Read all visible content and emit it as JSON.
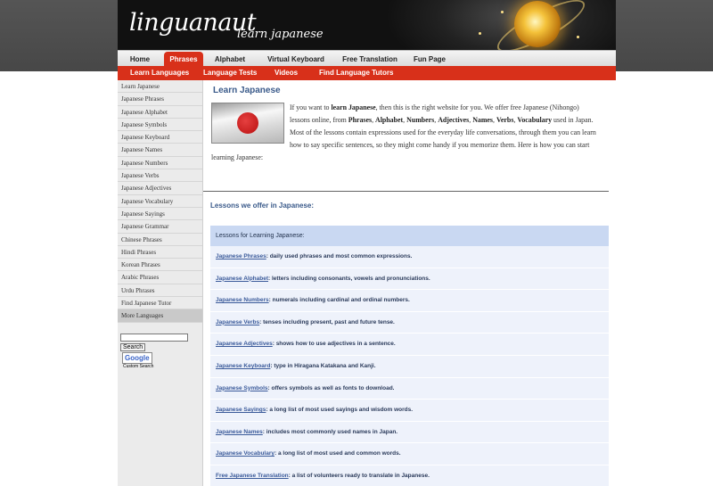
{
  "banner": {
    "logo": "linguanaut",
    "tagline": "learn japanese"
  },
  "nav_main": [
    {
      "label": "Home",
      "active": false
    },
    {
      "label": "Phrases",
      "active": true
    },
    {
      "label": "Alphabet",
      "active": false
    },
    {
      "label": "Virtual Keyboard",
      "active": false
    },
    {
      "label": "Free Translation",
      "active": false
    },
    {
      "label": "Fun Page",
      "active": false
    }
  ],
  "nav_sub": [
    "Learn Languages",
    "Language Tests",
    "Videos",
    "Find Language Tutors"
  ],
  "sidebar": {
    "items": [
      "Learn Japanese",
      "Japanese Phrases",
      "Japanese Alphabet",
      "Japanese Symbols",
      "Japanese Keyboard",
      "Japanese Names",
      "Japanese Numbers",
      "Japanese Verbs",
      "Japanese Adjectives",
      "Japanese Vocabulary",
      "Japanese Sayings",
      "Japanese Grammar",
      "Chinese Phrases",
      "Hindi Phrases",
      "Korean Phrases",
      "Arabic Phrases",
      "Urdu Phrases",
      "Find Japanese Tutor",
      "More Languages"
    ],
    "search_value": "",
    "search_button": "Search",
    "google_label": "Google",
    "custom_search": "Custom Search"
  },
  "main": {
    "title": "Learn Japanese",
    "intro": {
      "t1": "If you want to ",
      "b1": "learn Japanese",
      "t2": ", then this is the right website for you. We offer free Japanese (Nihongo) lessons online, from ",
      "b2": "Phrases",
      "t3": ", ",
      "b3": "Alphabet",
      "t4": ", ",
      "b4": "Numbers",
      "t5": ", ",
      "b5": "Adjectives",
      "t6": ", ",
      "b6": "Names",
      "t7": ", ",
      "b7": "Verbs",
      "t8": ", ",
      "b8": "Vocabulary",
      "t9": " used in Japan.",
      "p2": "Most of the lessons contain expressions used for the everyday life conversations, through them you can learn how to say specific sentences, so they might come handy if you memorize them. Here is how you can start learning Japanese:"
    },
    "lessons_title": "Lessons we offer in Japanese:",
    "lessons_header": "Lessons for Learning Japanese:",
    "lessons": [
      {
        "link": "Japanese Phrases",
        "desc": ": daily used phrases and most common expressions."
      },
      {
        "link": "Japanese Alphabet",
        "desc": ": letters including consonants, vowels and pronunciations."
      },
      {
        "link": "Japanese Numbers",
        "desc": ": numerals including cardinal and ordinal numbers."
      },
      {
        "link": "Japanese Verbs",
        "desc": ": tenses including present, past and future tense."
      },
      {
        "link": "Japanese Adjectives",
        "desc": ": shows how to use adjectives in a sentence."
      },
      {
        "link": "Japanese Keyboard",
        "desc": ": type in Hiragana Katakana and Kanji."
      },
      {
        "link": "Japanese Symbols",
        "desc": ": offers symbols as well as fonts to download."
      },
      {
        "link": "Japanese Sayings",
        "desc": ": a long list of most used sayings and wisdom words."
      },
      {
        "link": "Japanese Names",
        "desc": ": includes most commonly used names in Japan."
      },
      {
        "link": "Japanese Vocabulary",
        "desc": ": a long list of most used and common words."
      },
      {
        "link": "Free Japanese Translation",
        "desc": ": a list of volunteers ready to translate in Japanese."
      }
    ]
  }
}
